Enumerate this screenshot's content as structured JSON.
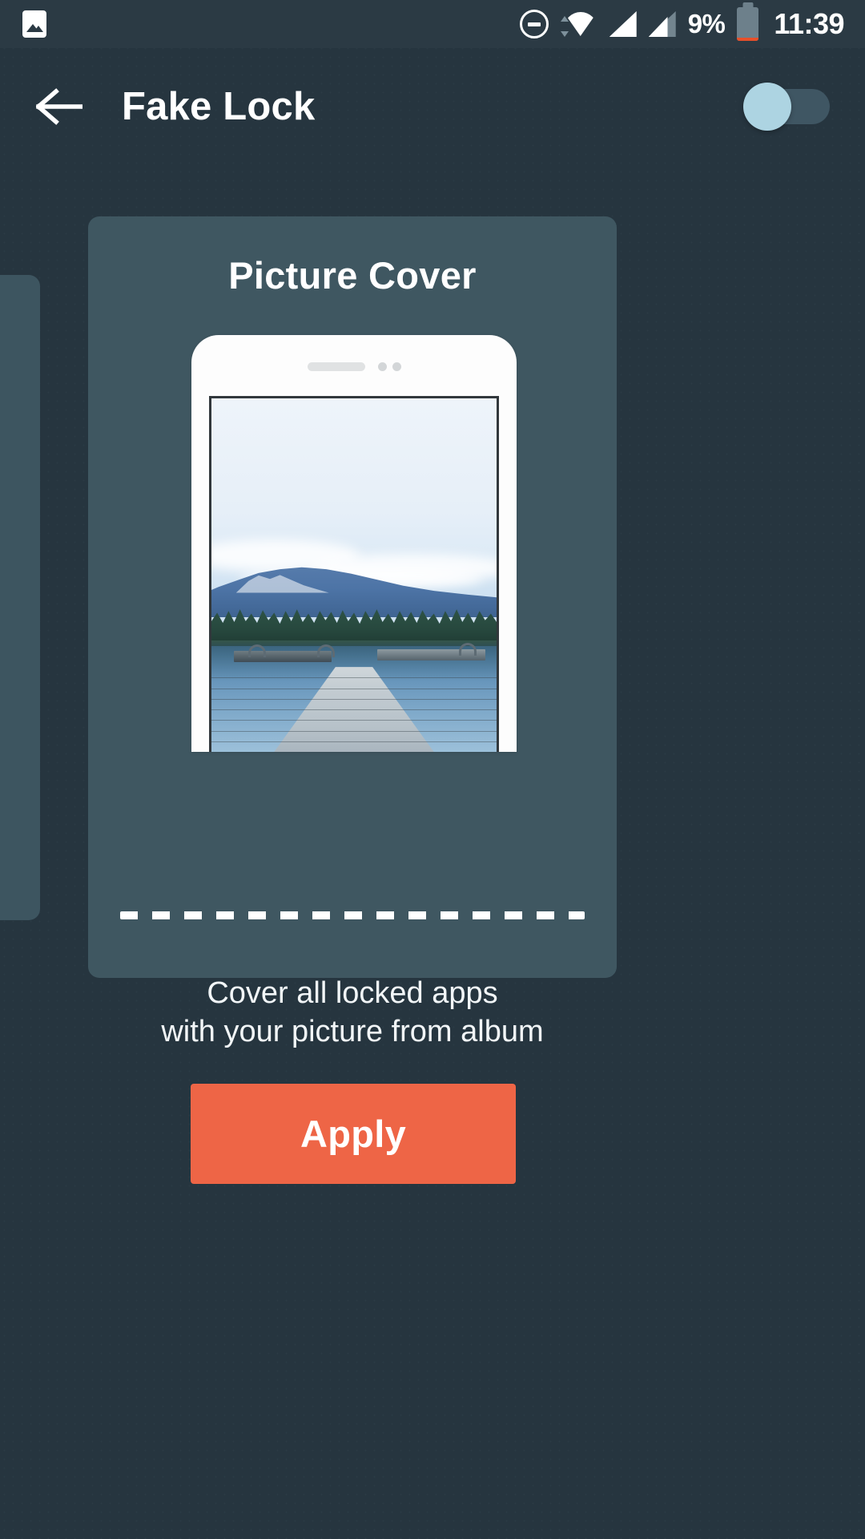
{
  "statusbar": {
    "gallery_icon": "gallery-icon",
    "dnd_icon": "do-not-disturb-icon",
    "wifi_icon": "wifi-icon",
    "signal_icon_1": "signal-bars-icon",
    "signal_icon_2": "signal-bars-icon",
    "battery_percent": "9%",
    "battery_icon": "battery-low-icon",
    "time": "11:39",
    "battery_level": 9,
    "low_battery_color": "#e8502a"
  },
  "appbar": {
    "back_icon": "back-arrow-icon",
    "title": "Fake Lock",
    "toggle": {
      "name": "fake-lock-toggle",
      "state": "off",
      "thumb_color": "#add4e2",
      "track_color": "#3f5663"
    }
  },
  "card": {
    "title": "Picture Cover",
    "description_line1": "Cover all locked apps",
    "description_line2": "with your picture from album",
    "background_color": "#3f5761",
    "phone_preview": {
      "name": "phone-mockup",
      "speaker_icon": "speaker-grille-icon",
      "camera_icon": "front-camera-icon",
      "wallpaper_description": "Lake with wooden dock, forest and mountains"
    },
    "cut_line": "dashed-cut-line"
  },
  "carousel": {
    "peek_card_left": "adjacent-cover-card"
  },
  "apply": {
    "label": "Apply",
    "color": "#ee6546"
  },
  "theme": {
    "page_background": "#26353f",
    "statusbar_background": "#2b3a44",
    "accent": "#ee6546"
  }
}
